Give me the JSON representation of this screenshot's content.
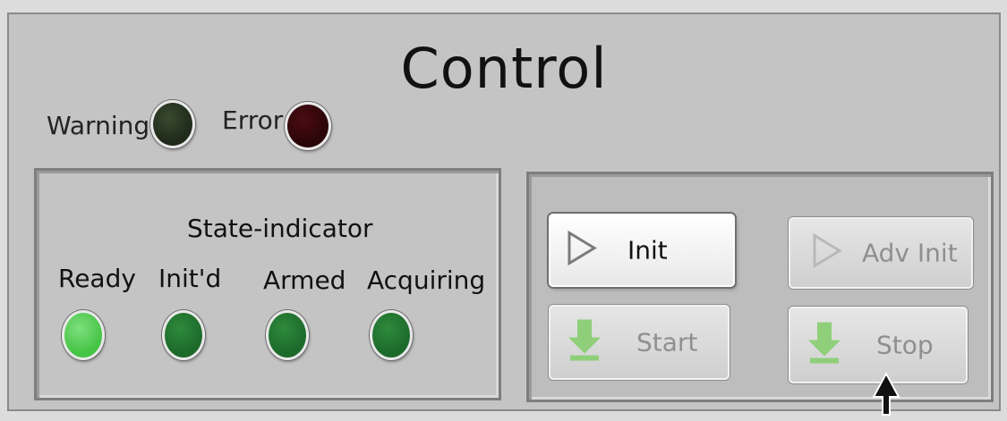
{
  "control": {
    "title": "Control",
    "warning_label": "Warning",
    "error_label": "Error",
    "warning_color": "#1f2a1a",
    "error_color": "#2a0508"
  },
  "state_indicator": {
    "title": "State-indicator",
    "items": [
      {
        "label": "Ready",
        "color": "#45c445",
        "lit": true
      },
      {
        "label": "Init'd",
        "color": "#1c6a2a",
        "lit": false
      },
      {
        "label": "Armed",
        "color": "#1c6a2a",
        "lit": false
      },
      {
        "label": "Acquiring",
        "color": "#1c6a2a",
        "lit": false
      }
    ]
  },
  "buttons": {
    "init": "Init",
    "adv_init": "Adv Init",
    "start": "Start",
    "stop": "Stop",
    "icon_arrow_green": "#8fcf7a"
  }
}
